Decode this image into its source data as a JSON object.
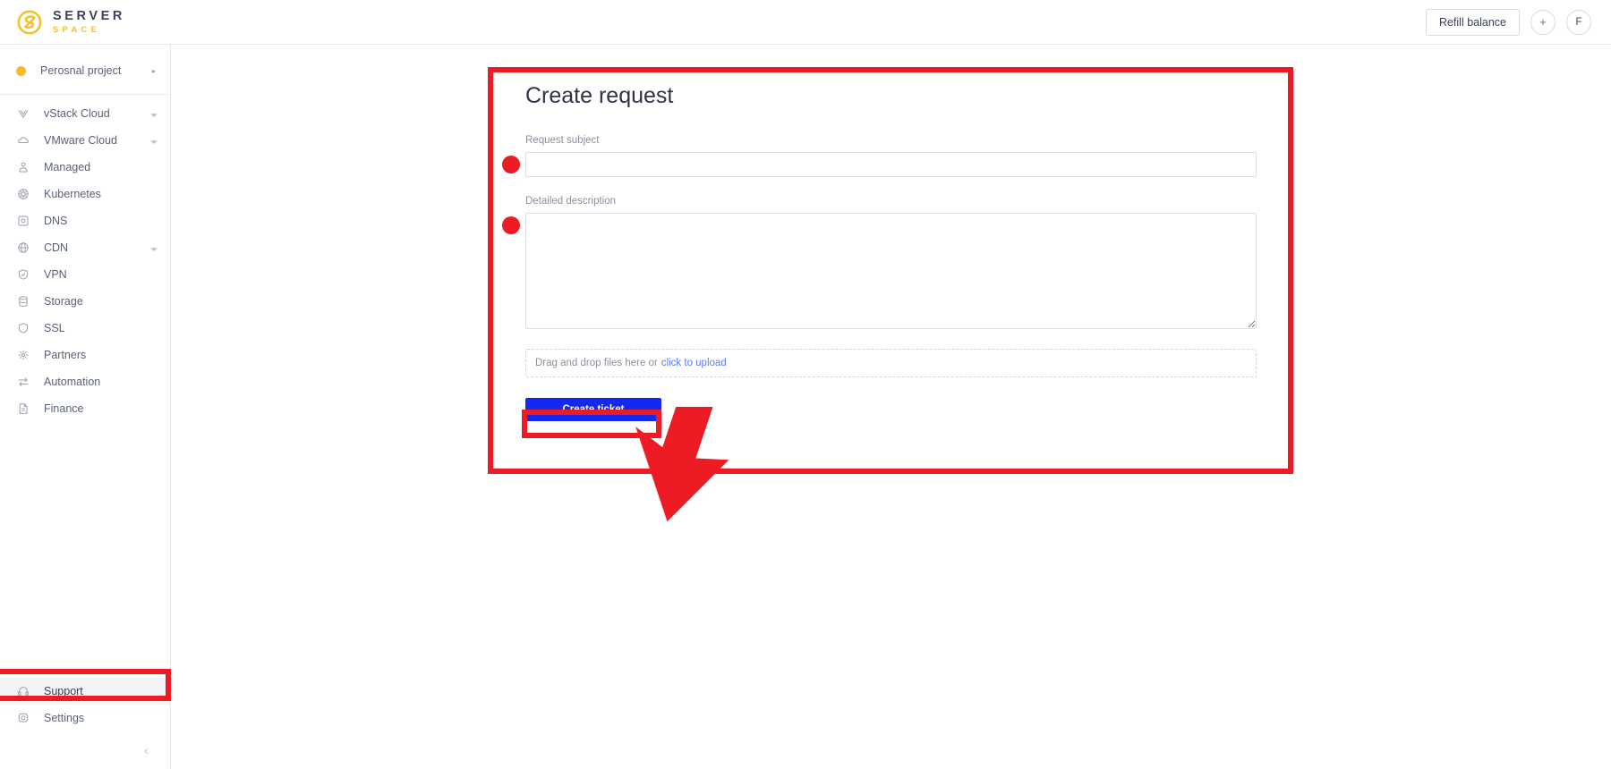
{
  "topbar": {
    "brand": {
      "name_top": "SERVER",
      "name_bottom": "SPACE",
      "logo_icon": "serverspace-s-logo-icon"
    },
    "refill_button": "Refill balance",
    "add_button": "+",
    "avatar_initial": "F"
  },
  "sidebar": {
    "project": {
      "label": "Perosnal project",
      "caret": "▸",
      "dot_color": "#f9b733"
    },
    "items": [
      {
        "label": "vStack Cloud",
        "icon": "vstack-icon",
        "expandable": true,
        "active": false
      },
      {
        "label": "VMware Cloud",
        "icon": "cloud-icon",
        "expandable": true,
        "active": false
      },
      {
        "label": "Managed",
        "icon": "managed-icon",
        "expandable": false,
        "active": false
      },
      {
        "label": "Kubernetes",
        "icon": "kubernetes-icon",
        "expandable": false,
        "active": false
      },
      {
        "label": "DNS",
        "icon": "dns-icon",
        "expandable": false,
        "active": false
      },
      {
        "label": "CDN",
        "icon": "globe-icon",
        "expandable": true,
        "active": false
      },
      {
        "label": "VPN",
        "icon": "vpn-shield-icon",
        "expandable": false,
        "active": false
      },
      {
        "label": "Storage",
        "icon": "storage-icon",
        "expandable": false,
        "active": false
      },
      {
        "label": "SSL",
        "icon": "ssl-shield-icon",
        "expandable": false,
        "active": false
      },
      {
        "label": "Partners",
        "icon": "partners-icon",
        "expandable": false,
        "active": false
      },
      {
        "label": "Automation",
        "icon": "automation-icon",
        "expandable": false,
        "active": false
      },
      {
        "label": "Finance",
        "icon": "finance-icon",
        "expandable": false,
        "active": false
      }
    ],
    "bottom_items": [
      {
        "label": "Support",
        "icon": "headset-icon",
        "active": true
      },
      {
        "label": "Settings",
        "icon": "gear-icon",
        "active": false
      }
    ],
    "collapse_chevron": "‹"
  },
  "main": {
    "title": "Create request",
    "subject": {
      "label": "Request subject",
      "value": "",
      "placeholder": ""
    },
    "description": {
      "label": "Detailed description",
      "value": "",
      "placeholder": ""
    },
    "dropzone": {
      "text": "Drag and drop files here or",
      "link": "click to upload"
    },
    "submit_label": "Create ticket"
  },
  "annotations": {
    "accent_color": "#ed1c24",
    "button_color": "#1429f0",
    "link_color": "#5b7cfa",
    "highlight_box_form": true,
    "highlight_box_support": true,
    "highlight_box_button": true,
    "marker_dots": 2,
    "cursor": "arrow-pointer"
  }
}
